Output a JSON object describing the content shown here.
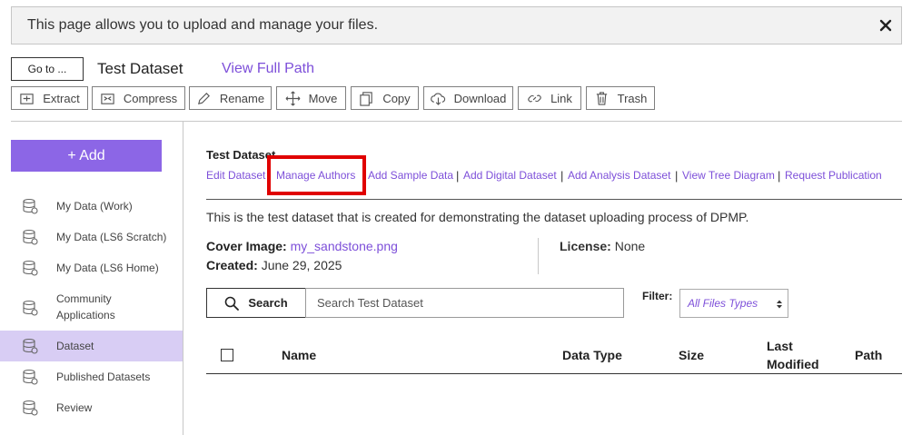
{
  "banner": {
    "message": "This page allows you to upload and manage your files."
  },
  "header": {
    "goto_label": "Go to ...",
    "dataset_title": "Test Dataset",
    "view_full_path": "View Full Path"
  },
  "toolbar": {
    "buttons": [
      {
        "label": "Extract",
        "icon": "extract-icon"
      },
      {
        "label": "Compress",
        "icon": "compress-icon"
      },
      {
        "label": "Rename",
        "icon": "pencil-icon"
      },
      {
        "label": "Move",
        "icon": "move-arrows-icon"
      },
      {
        "label": "Copy",
        "icon": "copy-icon"
      },
      {
        "label": "Download",
        "icon": "cloud-download-icon"
      },
      {
        "label": "Link",
        "icon": "link-icon"
      },
      {
        "label": "Trash",
        "icon": "trash-icon"
      }
    ]
  },
  "sidebar": {
    "add_label": "+ Add",
    "items": [
      {
        "label": "My Data (Work)",
        "icon": "database-icon",
        "active": false
      },
      {
        "label": "My Data (LS6 Scratch)",
        "icon": "database-icon",
        "active": false
      },
      {
        "label": "My Data (LS6 Home)",
        "icon": "database-icon",
        "active": false
      },
      {
        "label": "Community Applications",
        "icon": "database-icon",
        "active": false
      },
      {
        "label": "Dataset",
        "icon": "database-icon",
        "active": true
      },
      {
        "label": "Published Datasets",
        "icon": "database-icon",
        "active": false
      },
      {
        "label": "Review",
        "icon": "database-icon",
        "active": false
      }
    ]
  },
  "main": {
    "breadcrumb": "Test Dataset",
    "actions": [
      "Edit Dataset",
      "Manage Authors",
      "Add Sample Data",
      "Add Digital Dataset",
      "Add Analysis Dataset",
      "View Tree Diagram",
      "Request Publication"
    ],
    "description": "This is the test dataset that is created for demonstrating the dataset uploading process of DPMP.",
    "cover_image_label": "Cover Image:",
    "cover_image_value": "my_sandstone.png",
    "created_label": "Created:",
    "created_value": "June 29, 2025",
    "license_label": "License:",
    "license_value": "None",
    "search_button": "Search",
    "search_placeholder": "Search Test Dataset",
    "filter_label": "Filter:",
    "filter_value": "All Files Types",
    "columns": [
      "Name",
      "Data Type",
      "Size",
      "Last Modified",
      "Path"
    ]
  },
  "colors": {
    "accent": "#8c66e6",
    "link": "#7d4fd9",
    "active_bg": "#d8cdf4",
    "highlight": "#e00000"
  }
}
